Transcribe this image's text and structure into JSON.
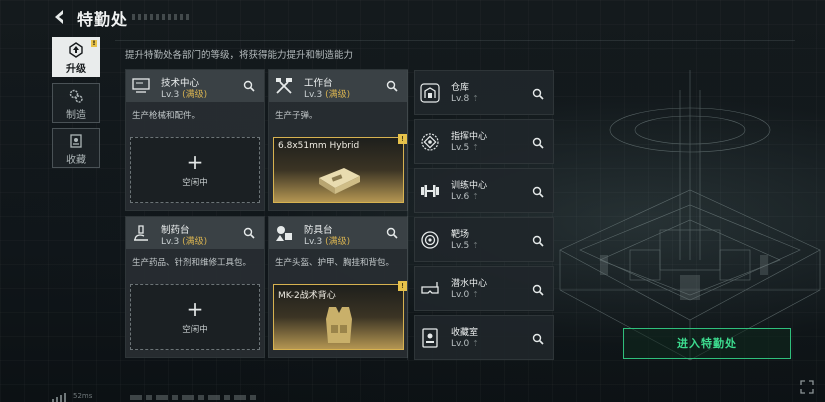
{
  "header": {
    "title": "特勤处"
  },
  "nav": [
    {
      "label": "升级",
      "icon": "upgrade-icon",
      "active": true,
      "badge": "!"
    },
    {
      "label": "制造",
      "icon": "gears-icon",
      "active": false
    },
    {
      "label": "收藏",
      "icon": "collection-icon",
      "active": false
    }
  ],
  "subtitle": "提升特勤处各部门的等级，将获得能力提升和制造能力",
  "workshops": [
    {
      "name": "技术中心",
      "level": "Lv.3",
      "level_tag": "(满级)",
      "desc": "生产枪械和配件。",
      "slot": {
        "type": "empty",
        "plus": "+",
        "text": "空闲中"
      }
    },
    {
      "name": "工作台",
      "level": "Lv.3",
      "level_tag": "(满级)",
      "desc": "生产子弹。",
      "slot": {
        "type": "item",
        "name": "6.8x51mm Hybrid",
        "badge": "!"
      }
    },
    {
      "name": "制药台",
      "level": "Lv.3",
      "level_tag": "(满级)",
      "desc": "生产药品、针剂和维修工具包。",
      "slot": {
        "type": "empty",
        "plus": "+",
        "text": "空闲中"
      }
    },
    {
      "name": "防具台",
      "level": "Lv.3",
      "level_tag": "(满级)",
      "desc": "生产头盔、护甲、胸挂和背包。",
      "slot": {
        "type": "item",
        "name": "MK-2战术背心",
        "badge": "!"
      }
    }
  ],
  "facilities": [
    {
      "name": "仓库",
      "level": "Lv.8",
      "icon": "warehouse-icon"
    },
    {
      "name": "指挥中心",
      "level": "Lv.5",
      "icon": "command-center-icon"
    },
    {
      "name": "训练中心",
      "level": "Lv.6",
      "icon": "dumbbell-icon"
    },
    {
      "name": "靶场",
      "level": "Lv.5",
      "icon": "target-icon"
    },
    {
      "name": "潜水中心",
      "level": "Lv.0",
      "icon": "diving-mask-icon"
    },
    {
      "name": "收藏室",
      "level": "Lv.0",
      "icon": "collection-room-icon"
    }
  ],
  "enter_button": "进入特勤处",
  "status": {
    "ping": "52ms"
  },
  "colors": {
    "accent_green": "#3ddc8f",
    "max_level_gold": "#d7b250",
    "badge_yellow": "#e7c24a"
  }
}
